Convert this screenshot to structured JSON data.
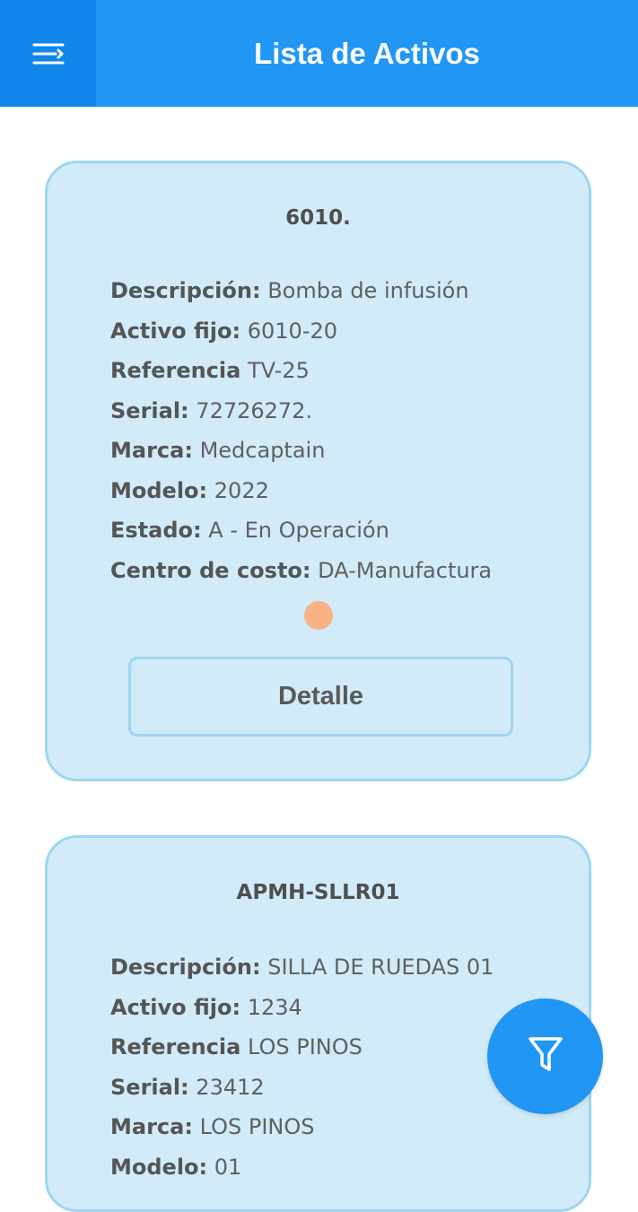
{
  "header": {
    "title": "Lista de Activos",
    "menu_icon": "menu-icon"
  },
  "assets": [
    {
      "code": "6010.",
      "fields": [
        {
          "label": "Descripción:",
          "value": "Bomba de infusión"
        },
        {
          "label": "Activo fijo:",
          "value": "6010-20"
        },
        {
          "label": "Referencia",
          "value": "TV-25"
        },
        {
          "label": "Serial:",
          "value": "72726272."
        },
        {
          "label": "Marca:",
          "value": "Medcaptain"
        },
        {
          "label": "Modelo:",
          "value": "2022"
        },
        {
          "label": "Estado:",
          "value": "A - En Operación"
        },
        {
          "label": "Centro de costo:",
          "value": "DA-Manufactura"
        }
      ],
      "status_color": "#f9b185",
      "detail_label": "Detalle"
    },
    {
      "code": "APMH-SLLR01",
      "fields": [
        {
          "label": "Descripción:",
          "value": "SILLA DE RUEDAS 01"
        },
        {
          "label": "Activo fijo:",
          "value": "1234"
        },
        {
          "label": "Referencia",
          "value": "LOS PINOS"
        },
        {
          "label": "Serial:",
          "value": "23412"
        },
        {
          "label": "Marca:",
          "value": "LOS PINOS"
        },
        {
          "label": "Modelo:",
          "value": "01"
        }
      ]
    }
  ],
  "fab": {
    "icon": "filter-icon"
  },
  "colors": {
    "primary": "#2196f3",
    "card_bg": "#d2ebf8",
    "card_border": "#9ed6ef"
  }
}
